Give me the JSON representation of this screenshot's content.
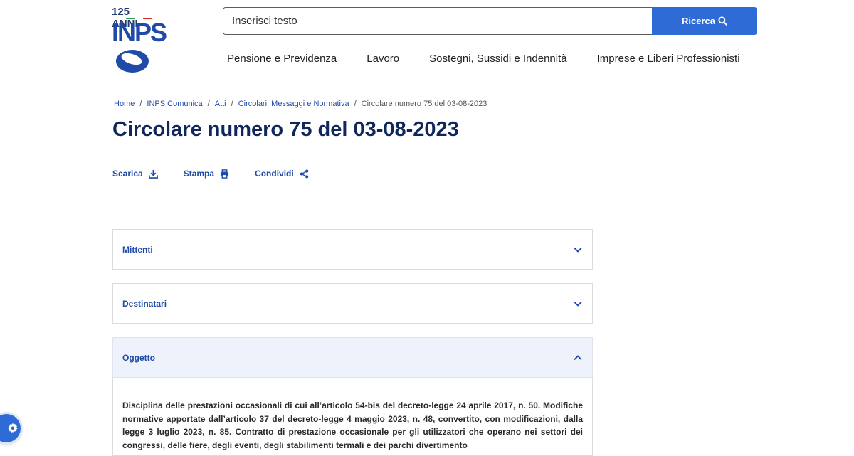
{
  "logo": {
    "anni_text": "125 ANNI",
    "brand_text": "INPS",
    "colors": {
      "brand_blue": "#1f4aa8",
      "dark_blue": "#213a70",
      "flag_green": "#2e9d4d",
      "flag_white": "#ffffff",
      "flag_red": "#d9262e"
    }
  },
  "search": {
    "placeholder": "Inserisci testo",
    "value": "",
    "button_label": "Ricerca",
    "button_icon": "search-icon"
  },
  "nav": {
    "items": [
      {
        "label": "Pensione e Previdenza"
      },
      {
        "label": "Lavoro"
      },
      {
        "label": "Sostegni, Sussidi e Indennità"
      },
      {
        "label": "Imprese e Liberi Professionisti"
      }
    ]
  },
  "breadcrumb": {
    "items": [
      {
        "label": "Home"
      },
      {
        "label": "INPS Comunica"
      },
      {
        "label": "Atti"
      },
      {
        "label": "Circolari, Messaggi e Normativa"
      }
    ],
    "current": "Circolare numero 75 del 03-08-2023",
    "separator": "/"
  },
  "page": {
    "title": "Circolare numero 75 del 03-08-2023"
  },
  "actions": [
    {
      "label": "Scarica",
      "icon": "download-icon"
    },
    {
      "label": "Stampa",
      "icon": "print-icon"
    },
    {
      "label": "Condividi",
      "icon": "share-icon"
    }
  ],
  "accordions": [
    {
      "label": "Mittenti",
      "expanded": false
    },
    {
      "label": "Destinatari",
      "expanded": false
    },
    {
      "label": "Oggetto",
      "expanded": true,
      "body": "Disciplina delle prestazioni occasionali di cui all’articolo 54-bis del decreto-legge 24 aprile 2017, n. 50. Modifiche normative apportate dall’articolo 37 del decreto-legge 4 maggio 2023, n. 48, convertito, con modificazioni, dalla legge 3 luglio 2023, n. 85. Contratto di prestazione occasionale per gli utilizzatori che operano nei settori dei congressi, delle fiere, degli eventi, degli stabilimenti termali e dei parchi divertimento"
    }
  ],
  "accessibility_button": {
    "icon": "gear-icon"
  },
  "colors": {
    "accent": "#2f6bd6",
    "link": "#1f4aa8",
    "title": "#10275c"
  }
}
